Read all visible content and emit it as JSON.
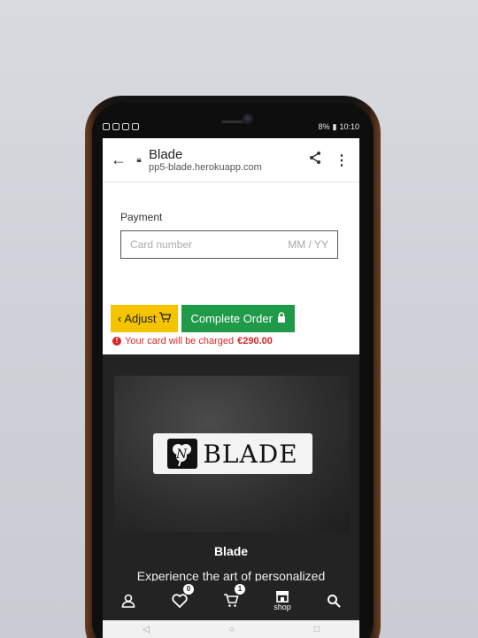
{
  "status": {
    "time": "10:10",
    "battery": "8%"
  },
  "browser": {
    "title": "Blade",
    "url": "pp5-blade.herokuapp.com"
  },
  "payment": {
    "label": "Payment",
    "card_placeholder": "Card number",
    "expiry_placeholder": "MM / YY"
  },
  "actions": {
    "adjust_label": "Adjust",
    "complete_label": "Complete Order"
  },
  "charge": {
    "text": "Your card will be charged",
    "amount": "€290.00"
  },
  "footer": {
    "logo_text": "BLADE",
    "brand": "Blade",
    "tagline": "Experience the art of personalized"
  },
  "bottom_nav": {
    "wishlist_count": "0",
    "cart_count": "1",
    "shop_label": "shop"
  },
  "colors": {
    "adjust_bg": "#f5c400",
    "complete_bg": "#1f9a48",
    "warning": "#d82525",
    "footer_bg": "#232323"
  },
  "icons": [
    "back-arrow-icon",
    "lock-icon",
    "share-icon",
    "more-vert-icon",
    "chevron-left-icon",
    "cart-icon",
    "warning-icon",
    "user-icon",
    "heart-icon",
    "shop-icon",
    "search-icon"
  ]
}
